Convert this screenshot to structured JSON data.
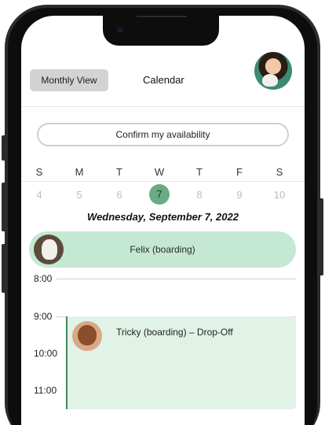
{
  "header": {
    "monthly_view_label": "Monthly View",
    "title": "Calendar",
    "avatar_icon": "user-avatar-photo"
  },
  "availability": {
    "confirm_label": "Confirm my availability"
  },
  "week": {
    "days": [
      {
        "weekday": "S",
        "date": "4"
      },
      {
        "weekday": "M",
        "date": "5"
      },
      {
        "weekday": "T",
        "date": "6"
      },
      {
        "weekday": "W",
        "date": "7"
      },
      {
        "weekday": "T",
        "date": "8"
      },
      {
        "weekday": "F",
        "date": "9"
      },
      {
        "weekday": "S",
        "date": "10"
      }
    ],
    "selected_date": "7"
  },
  "day": {
    "heading": "Wednesday, September 7, 2022",
    "all_day_event": {
      "label": "Felix (boarding)",
      "pet_icon": "dog-photo-felix"
    },
    "time_slots": [
      "8:00",
      "9:00",
      "10:00",
      "11:00"
    ],
    "events": [
      {
        "title": "Tricky (boarding) – Drop-Off",
        "pet_icon": "dog-photo-tricky",
        "start": "9:00"
      }
    ]
  },
  "colors": {
    "selected_day": "#6aaa86",
    "all_day_event_bg": "#c4e8d3",
    "event_bg": "#e0f3e6",
    "event_accent": "#3f8a5f",
    "monthly_button_bg": "#d3d3d3"
  }
}
